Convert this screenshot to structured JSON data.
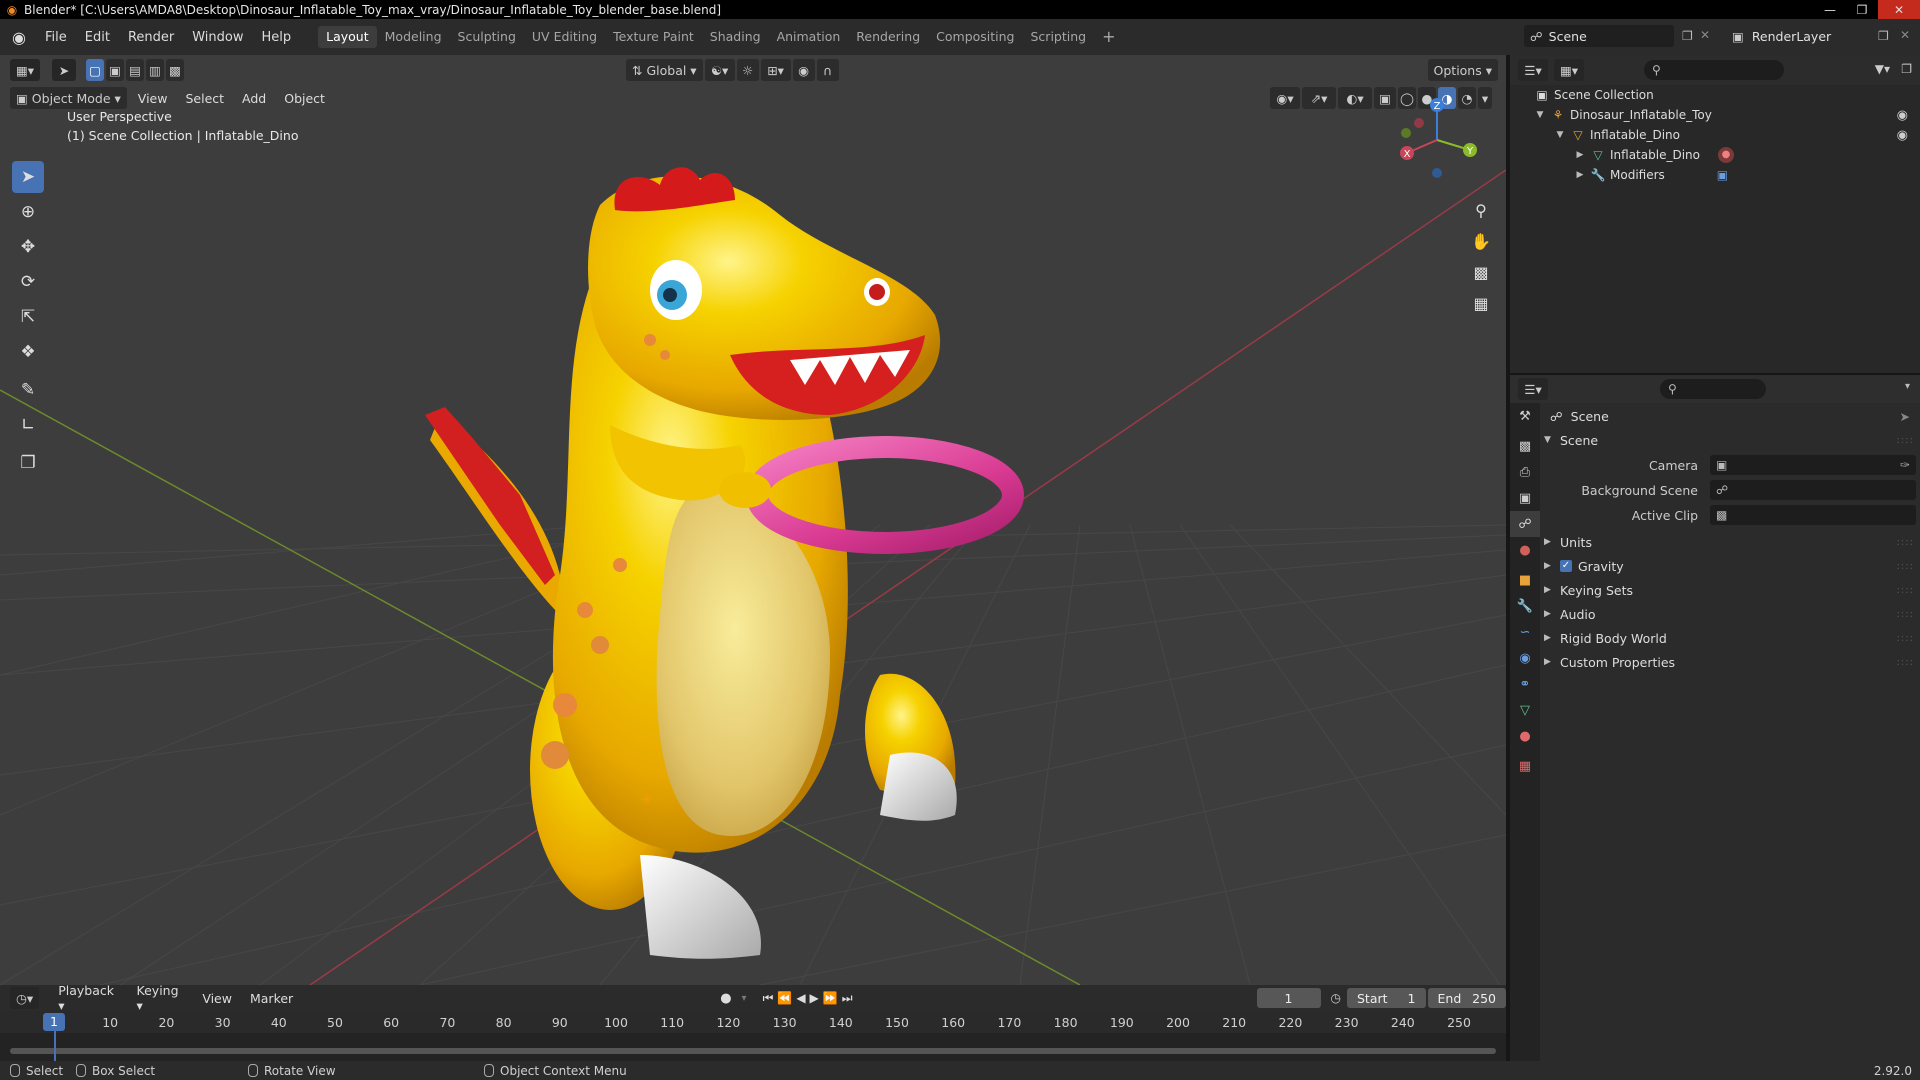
{
  "titlebar": {
    "title": "Blender* [C:\\Users\\AMDA8\\Desktop\\Dinosaur_Inflatable_Toy_max_vray/Dinosaur_Inflatable_Toy_blender_base.blend]"
  },
  "menu": [
    "File",
    "Edit",
    "Render",
    "Window",
    "Help"
  ],
  "workspaces": [
    "Layout",
    "Modeling",
    "Sculpting",
    "UV Editing",
    "Texture Paint",
    "Shading",
    "Animation",
    "Rendering",
    "Compositing",
    "Scripting"
  ],
  "workspace_add": "+",
  "scene_selector": {
    "value": "Scene"
  },
  "renderlayer_selector": {
    "value": "RenderLayer"
  },
  "viewport": {
    "transform_orientation": "Global",
    "options_label": "Options",
    "mode": "Object Mode",
    "menus": [
      "View",
      "Select",
      "Add",
      "Object"
    ],
    "overlay_line1": "User Perspective",
    "overlay_line2": "(1) Scene Collection | Inflatable_Dino",
    "gizmo": {
      "x": "X",
      "y": "Y",
      "z": "Z"
    }
  },
  "outliner": {
    "rows": [
      {
        "label": "Scene Collection",
        "icon": "collection-icon"
      },
      {
        "label": "Dinosaur_Inflatable_Toy",
        "icon": "empty-icon"
      },
      {
        "label": "Inflatable_Dino",
        "icon": "object-icon"
      },
      {
        "label": "Inflatable_Dino",
        "icon": "mesh-icon"
      },
      {
        "label": "Modifiers",
        "icon": "wrench-icon"
      }
    ]
  },
  "properties": {
    "header": "Scene",
    "panel_title": "Scene",
    "fields": [
      {
        "label": "Camera"
      },
      {
        "label": "Background Scene"
      },
      {
        "label": "Active Clip"
      }
    ],
    "sections": [
      "Units",
      "Gravity",
      "Keying Sets",
      "Audio",
      "Rigid Body World",
      "Custom Properties"
    ],
    "gravity_checked": true
  },
  "timeline": {
    "menus": [
      "Playback",
      "Keying",
      "View",
      "Marker"
    ],
    "current_frame": "1",
    "start_label": "Start",
    "start_value": "1",
    "end_label": "End",
    "end_value": "250",
    "ticks": [
      "10",
      "20",
      "30",
      "40",
      "50",
      "60",
      "70",
      "80",
      "90",
      "100",
      "110",
      "120",
      "130",
      "140",
      "150",
      "160",
      "170",
      "180",
      "190",
      "200",
      "210",
      "220",
      "230",
      "240",
      "250"
    ],
    "playhead_label": "1"
  },
  "statusbar": {
    "select": "Select",
    "box_select": "Box Select",
    "rotate_view": "Rotate View",
    "context_menu": "Object Context Menu",
    "version": "2.92.0"
  },
  "colors": {
    "accent": "#4772b3",
    "x_axis": "#c8455a",
    "y_axis": "#8bbb2a",
    "z_axis": "#3a7fd9",
    "dino_yellow": "#f3c400",
    "ring_pink": "#e0479b"
  }
}
